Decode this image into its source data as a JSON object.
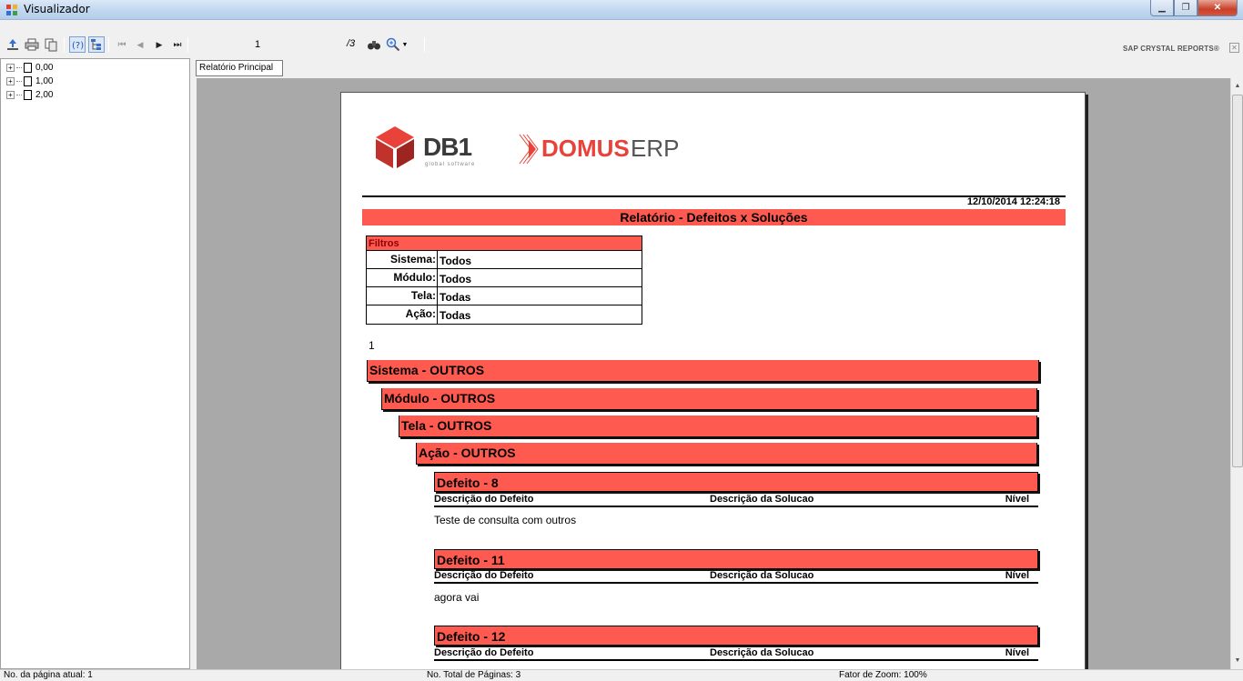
{
  "window": {
    "title": "Visualizador"
  },
  "toolbar": {
    "current_page": "1",
    "total_pages": "/3",
    "brand": "SAP CRYSTAL REPORTS®"
  },
  "tree": {
    "items": [
      {
        "label": "0,00"
      },
      {
        "label": "1,00"
      },
      {
        "label": "2,00"
      }
    ]
  },
  "tab": {
    "label": "Relatório Principal"
  },
  "report": {
    "logo": {
      "db1": "DB1",
      "db1_sub": "global software",
      "domus": "DOMUS",
      "erp": "ERP"
    },
    "datetime": "12/10/2014 12:24:18",
    "title": "Relatório - Defeitos x Soluções",
    "filters": {
      "header": "Filtros",
      "rows": [
        {
          "label": "Sistema:",
          "value": "Todos"
        },
        {
          "label": "Módulo:",
          "value": "Todos"
        },
        {
          "label": "Tela:",
          "value": "Todas"
        },
        {
          "label": "Ação:",
          "value": "Todas"
        }
      ]
    },
    "page_number": "1",
    "sistema": "Sistema - OUTROS",
    "modulo": "Módulo - OUTROS",
    "tela": "Tela - OUTROS",
    "acao": "Ação - OUTROS",
    "columns": {
      "desc_defeito": "Descrição do Defeito",
      "desc_solucao": "Descrição da Solucao",
      "nivel": "Nível"
    },
    "defects": [
      {
        "title": "Defeito - 8",
        "description": "Teste de consulta com outros"
      },
      {
        "title": "Defeito - 11",
        "description": "agora vai"
      },
      {
        "title": "Defeito - 12",
        "description": ""
      }
    ]
  },
  "status": {
    "current_page": "No. da página atual: 1",
    "total_pages": "No. Total de Páginas: 3",
    "zoom": "Fator de Zoom: 100%"
  },
  "colors": {
    "band": "#ff5a4f",
    "viewer_bg": "#a9a9a9",
    "domus": "#e8423a"
  },
  "icons": [
    "export-icon",
    "print-icon",
    "copy-icon",
    "help-icon",
    "group-tree-icon",
    "first-page-icon",
    "prev-page-icon",
    "next-page-icon",
    "last-page-icon",
    "find-icon",
    "zoom-icon"
  ]
}
